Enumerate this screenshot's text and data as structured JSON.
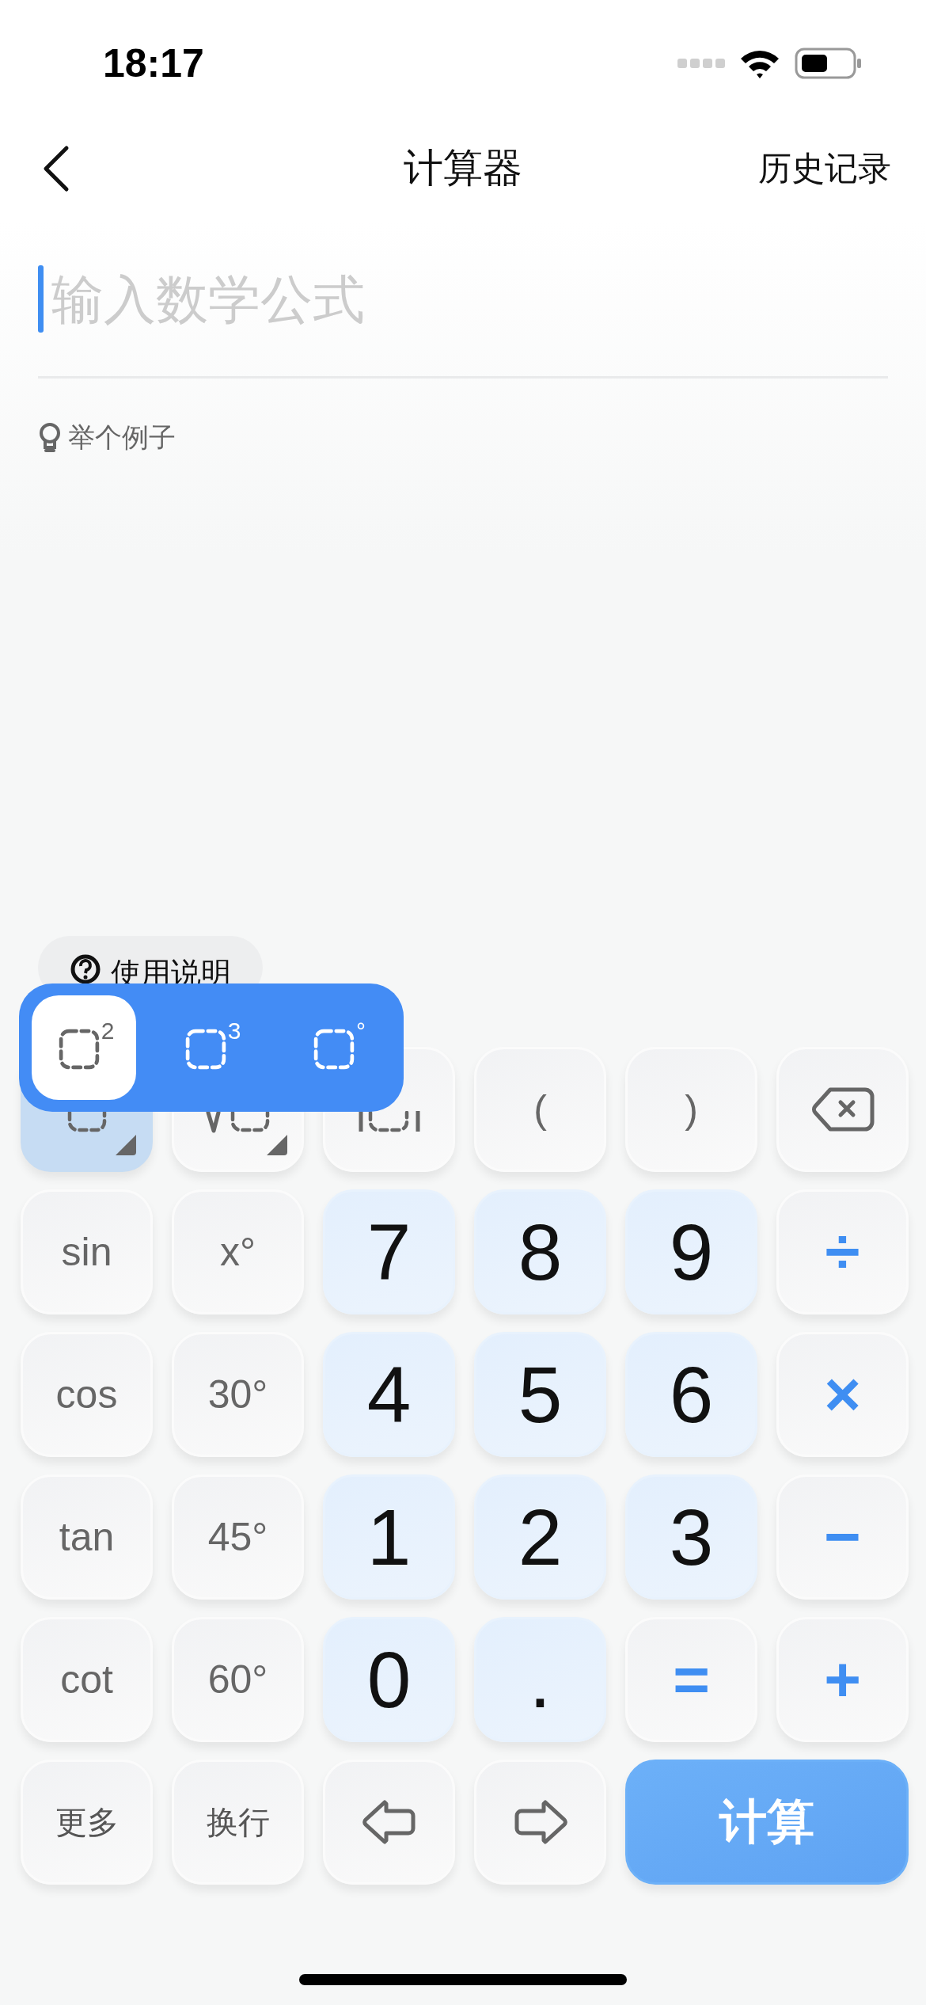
{
  "status_bar": {
    "time": "18:17"
  },
  "header": {
    "title": "计算器",
    "action": "历史记录"
  },
  "input": {
    "placeholder": "输入数学公式",
    "focused": true
  },
  "example_link": "举个例子",
  "help_button": "使用说明",
  "keys": [
    {
      "kind": "square",
      "menu": true,
      "expanded": true
    },
    {
      "kind": "sqrt",
      "menu": true,
      "expanded": false
    },
    {
      "kind": "abs"
    },
    {
      "kind": "text",
      "label": "("
    },
    {
      "kind": "text",
      "label": ")"
    },
    {
      "kind": "backspace"
    },
    {
      "kind": "text",
      "label": "sin"
    },
    {
      "kind": "text",
      "label": "x°"
    },
    {
      "kind": "digit",
      "label": "7"
    },
    {
      "kind": "digit",
      "label": "8"
    },
    {
      "kind": "digit",
      "label": "9"
    },
    {
      "kind": "operator",
      "label": "÷"
    },
    {
      "kind": "text",
      "label": "cos"
    },
    {
      "kind": "text",
      "label": "30°"
    },
    {
      "kind": "digit",
      "label": "4"
    },
    {
      "kind": "digit",
      "label": "5"
    },
    {
      "kind": "digit",
      "label": "6"
    },
    {
      "kind": "operator",
      "label": "×"
    },
    {
      "kind": "text",
      "label": "tan"
    },
    {
      "kind": "text",
      "label": "45°"
    },
    {
      "kind": "digit",
      "label": "1"
    },
    {
      "kind": "digit",
      "label": "2"
    },
    {
      "kind": "digit",
      "label": "3"
    },
    {
      "kind": "operator",
      "label": "−"
    },
    {
      "kind": "text",
      "label": "cot"
    },
    {
      "kind": "text",
      "label": "60°"
    },
    {
      "kind": "digit",
      "label": "0"
    },
    {
      "kind": "digit",
      "label": "."
    },
    {
      "kind": "operator",
      "label": "="
    },
    {
      "kind": "operator",
      "label": "+"
    },
    {
      "kind": "word",
      "label": "更多"
    },
    {
      "kind": "word",
      "label": "换行"
    },
    {
      "kind": "left"
    },
    {
      "kind": "right"
    },
    {
      "kind": "submit",
      "label": "计算"
    }
  ],
  "popup": {
    "options": [
      {
        "sup": "2",
        "selected": true
      },
      {
        "sup": "3",
        "selected": false
      },
      {
        "sup": "°",
        "selected": false
      }
    ]
  }
}
